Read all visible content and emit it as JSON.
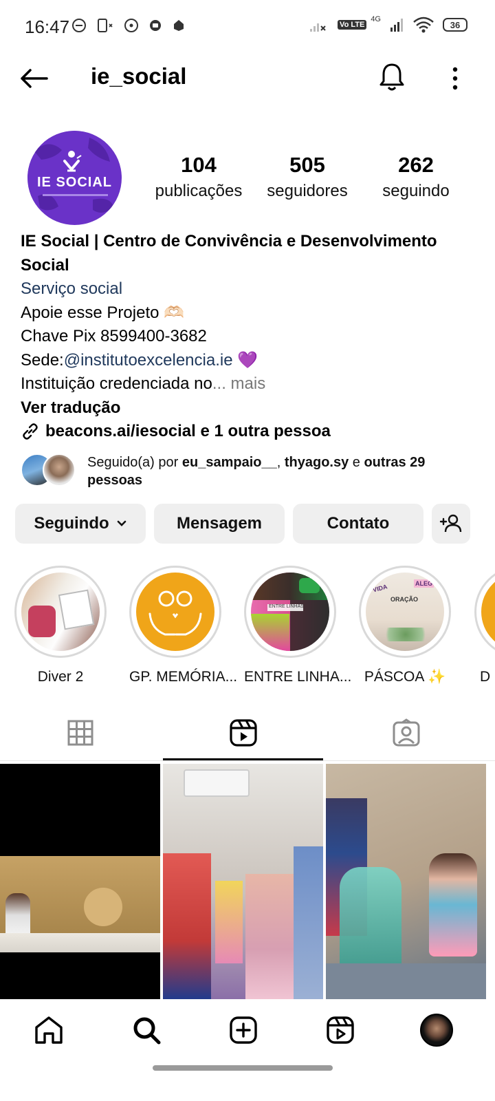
{
  "status_bar": {
    "time": "16:47",
    "network_badge": "Vo LTE",
    "network_type": "4G",
    "battery": "36"
  },
  "header": {
    "username": "ie_social"
  },
  "profile": {
    "avatar_text": "IE SOCIAL",
    "stats": [
      {
        "value": "104",
        "label": "publicações"
      },
      {
        "value": "505",
        "label": "seguidores"
      },
      {
        "value": "262",
        "label": "seguindo"
      }
    ],
    "bio": {
      "name": "IE Social | Centro de Convivência e Desenvolvimento Social",
      "category": "Serviço social",
      "line1": "Apoie esse Projeto 🫶🏻",
      "line2": "Chave Pix 8599400-3682",
      "line3_prefix": "Sede:",
      "line3_mention": "@institutoexcelencia.ie",
      "line3_emoji": " 💜",
      "line4_text": "Instituição credenciada no",
      "line4_more": "... mais",
      "translate": "Ver tradução",
      "link": "beacons.ai/iesocial e 1 outra pessoa"
    },
    "followed_by": {
      "prefix": "Seguido(a) por ",
      "user1": "eu_sampaio__",
      "sep": ", ",
      "user2": "thyago.sy",
      "mid": " e ",
      "rest": "outras 29 pessoas"
    }
  },
  "actions": {
    "following": "Seguindo",
    "message": "Mensagem",
    "contact": "Contato"
  },
  "highlights": [
    {
      "label": "Diver 2"
    },
    {
      "label": "GP. MEMÓRIA..."
    },
    {
      "label": "ENTRE LINHA..."
    },
    {
      "label": "PÁSCOA ✨"
    },
    {
      "label": "D"
    }
  ],
  "highlight_overlay": {
    "entre_linhas": "ENTRE LINHAS",
    "vida": "VIDA",
    "alegria": "ALEG",
    "oracao": "ORAÇÃO"
  },
  "colors": {
    "accent_purple": "#6a32c8",
    "link_blue": "#20395c",
    "memoria_orange": "#f0a519"
  }
}
